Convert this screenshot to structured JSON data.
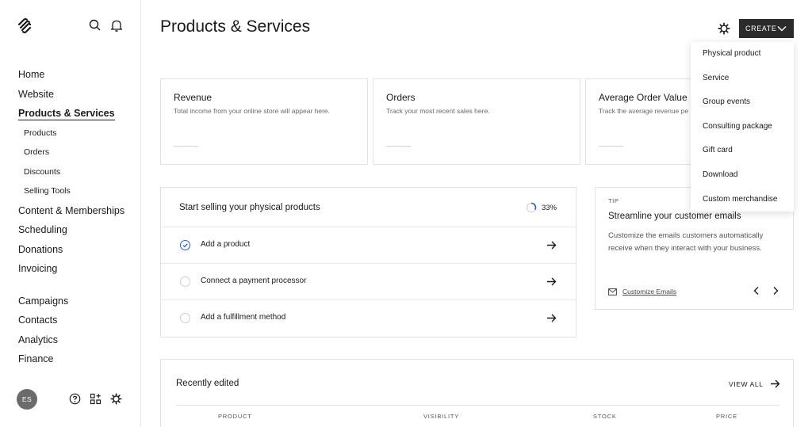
{
  "sidebar": {
    "nav": [
      "Home",
      "Website",
      "Products & Services"
    ],
    "sub": [
      "Products",
      "Orders",
      "Discounts",
      "Selling Tools"
    ],
    "nav2": [
      "Content & Memberships",
      "Scheduling",
      "Donations",
      "Invoicing"
    ],
    "nav3": [
      "Campaigns",
      "Contacts",
      "Analytics",
      "Finance"
    ],
    "avatar_initials": "ES"
  },
  "header": {
    "title": "Products & Services",
    "create_label": "CREATE"
  },
  "stats": [
    {
      "title": "Revenue",
      "desc": "Total income from your online store will appear here."
    },
    {
      "title": "Orders",
      "desc": "Track your most recent sales here."
    },
    {
      "title": "Average Order Value",
      "desc": "Track the average revenue pe"
    }
  ],
  "setup": {
    "title": "Start selling your physical products",
    "progress": "33%",
    "progress_fraction": 0.33,
    "tasks": [
      {
        "label": "Add a product",
        "done": true
      },
      {
        "label": "Connect a payment processor",
        "done": false
      },
      {
        "label": "Add a fulfillment method",
        "done": false
      }
    ]
  },
  "tip": {
    "eyebrow": "TIP",
    "title": "Streamline your customer emails",
    "body": "Customize the emails customers automatically receive when they interact with your business.",
    "link": "Customize Emails"
  },
  "recent": {
    "title": "Recently edited",
    "view_all": "VIEW ALL",
    "columns": [
      "PRODUCT",
      "VISIBILITY",
      "STOCK",
      "PRICE"
    ]
  },
  "create_menu": [
    "Physical product",
    "Service",
    "Group events",
    "Consulting package",
    "Gift card",
    "Download",
    "Custom merchandise"
  ],
  "colors": {
    "accent": "#2a5bd7",
    "button_dark": "#2b2b2b",
    "avatar": "#6b6b6b"
  }
}
